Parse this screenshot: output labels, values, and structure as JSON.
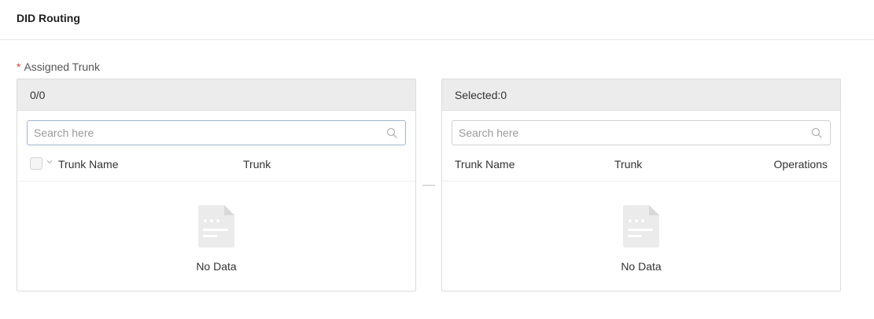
{
  "header": {
    "title": "DID Routing"
  },
  "field": {
    "required_mark": "*",
    "label": "Assigned Trunk"
  },
  "left_panel": {
    "count": "0/0",
    "search_placeholder": "Search here",
    "columns": [
      "Trunk Name",
      "Trunk"
    ],
    "empty_text": "No Data"
  },
  "right_panel": {
    "count": "Selected:0",
    "search_placeholder": "Search here",
    "columns": [
      "Trunk Name",
      "Trunk",
      "Operations"
    ],
    "empty_text": "No Data"
  },
  "icons": {
    "search": "search-icon",
    "empty": "empty-document-icon",
    "chevron": "chevron-down-icon"
  },
  "colors": {
    "required": "#e4393c",
    "panel_header_bg": "#ececec",
    "border": "#dcdcdc"
  }
}
